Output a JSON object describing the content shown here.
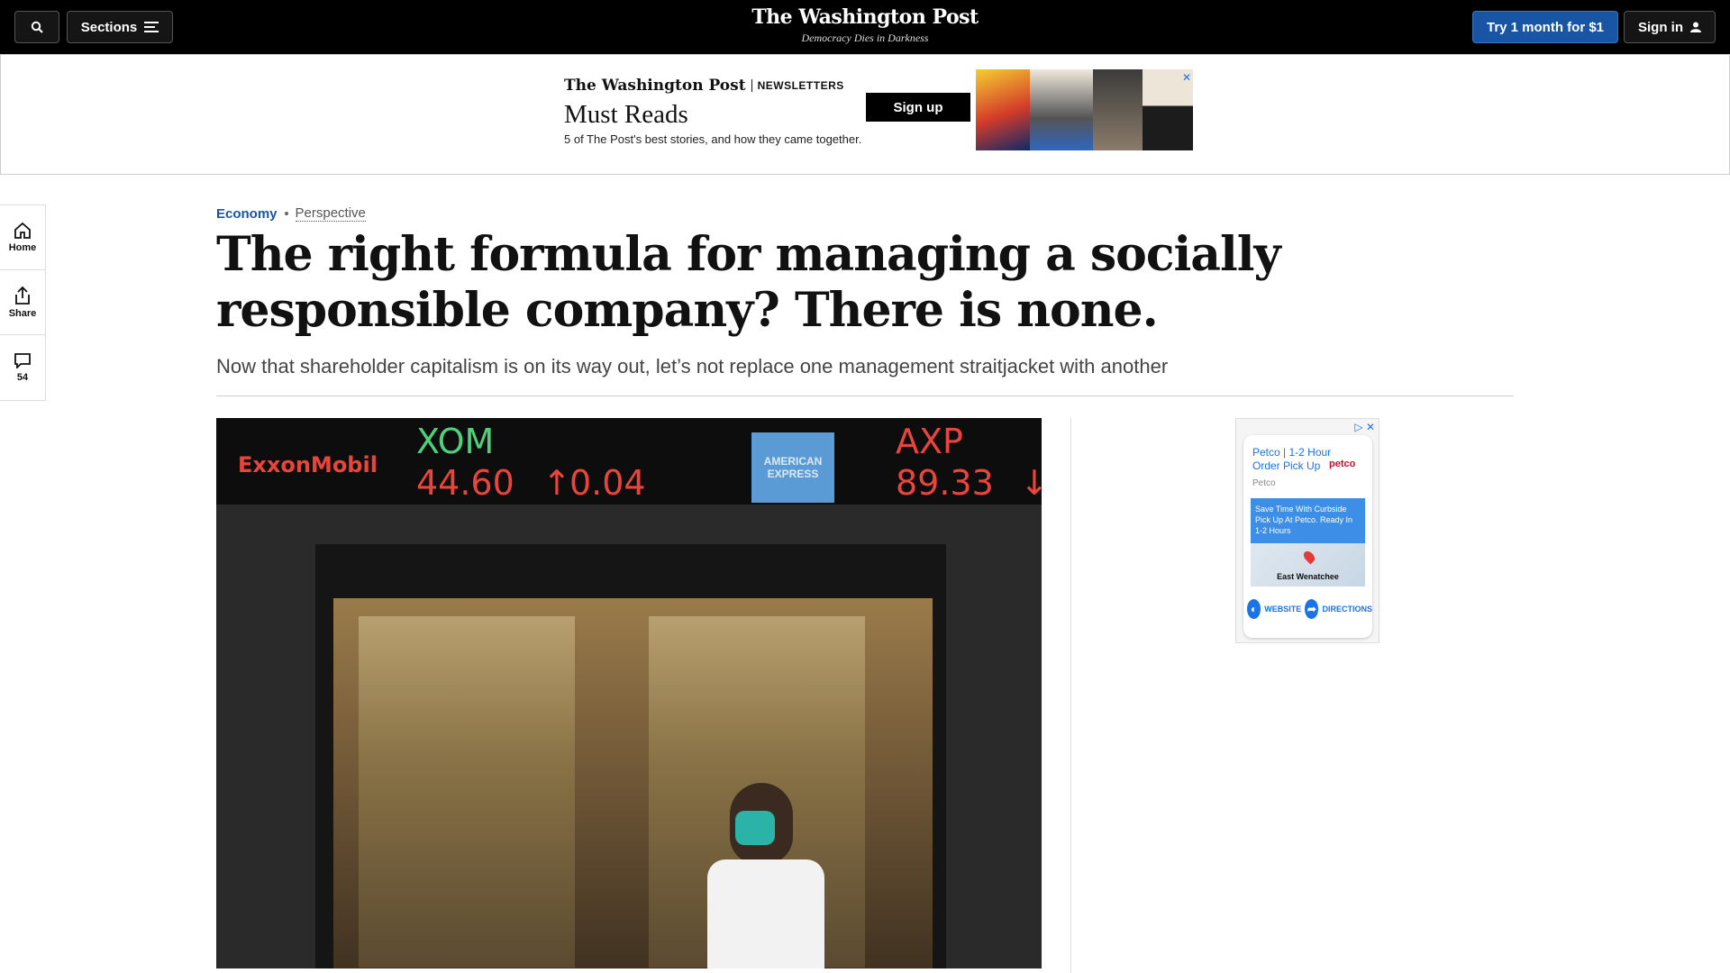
{
  "topbar": {
    "sections_label": "Sections",
    "logo_name": "The Washington Post",
    "logo_tagline": "Democracy Dies in Darkness",
    "subscribe_label": "Try 1 month for $1",
    "signin_label": "Sign in"
  },
  "newsletter_ad": {
    "brand": "The Washington Post",
    "brand_suffix": "NEWSLETTERS",
    "title": "Must Reads",
    "description": "5 of The Post's best stories, and how they came together.",
    "cta": "Sign up"
  },
  "rail": {
    "home_label": "Home",
    "share_label": "Share",
    "comments_count": "54"
  },
  "article": {
    "section": "Economy",
    "label": "Perspective",
    "headline": "The right formula for managing a socially responsible company? There is none.",
    "dek": "Now that shareholder capitalism is on its way out, let’s not replace one management straitjacket with another"
  },
  "photo": {
    "ticker_company": "ExxonMobil",
    "ticker_symbol_1": "XOM",
    "ticker_price_1": "44.60",
    "ticker_change_1": "0.04",
    "ticker_symbol_2": "AXP",
    "ticker_price_2": "89.33",
    "amex_text": "AMERICAN EXPRESS"
  },
  "side_ad": {
    "title": "Petco | 1-2 Hour Order Pick Up",
    "logo": "petco",
    "source": "Petco",
    "promo": "Save Time With Curbside Pick Up At Petco. Ready In 1-2 Hours",
    "city": "East Wenatchee",
    "website_label": "WEBSITE",
    "directions_label": "DIRECTIONS"
  },
  "colors": {
    "accent": "#1955a5",
    "ticker_red": "#e8453c",
    "ticker_green": "#4fd07a"
  }
}
